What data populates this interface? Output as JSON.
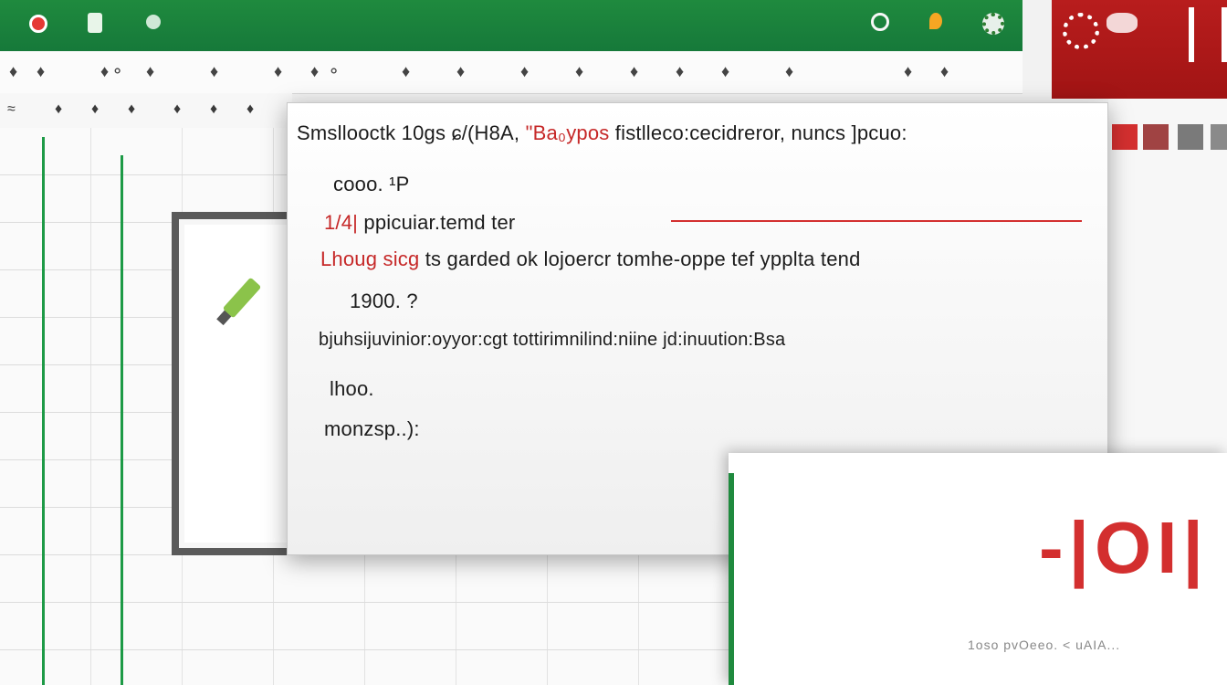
{
  "titlebar": {
    "icons": [
      "record-icon",
      "document-icon",
      "dot-icon",
      "search-icon",
      "pin-icon",
      "gear-icon"
    ]
  },
  "ribbon": {
    "items": [
      "♦",
      "♦",
      "♦⚬",
      "♦",
      "♦",
      "♦",
      "♦ ⚬",
      "♦",
      "♦",
      "♦",
      "♦",
      "♦",
      "♦",
      "♦",
      "♦",
      "♦",
      "♦",
      "♦",
      "♦",
      "♦",
      "♦",
      "♦"
    ]
  },
  "tabs": {
    "items": [
      "≈",
      "♦",
      "♦",
      "♦",
      "♦",
      "♦",
      "♦",
      "♦"
    ]
  },
  "dialog": {
    "line1_pre": "Smsllooctk 10gs",
    "line1_mid": "ɕ/(H8A,",
    "line1_hl": "\"Ba₀ypos",
    "line1_post": "fistlleco:cecidreror, nuncs ]pcuo:",
    "line2": "cooo. ¹P",
    "line3_hl": "1/4|",
    "line3_post": "ppicuiar.temd ter",
    "line4_hl": "Lhoug sicg",
    "line4_post": "ts garded ok lojoercr tomhe-oppe tef ypplta tend",
    "line5": "1900. ?",
    "line6": "bjuhsijuvinior:oyyor:cgt tottirimnilind:niine jd:inuution:Bsa",
    "line7": "lhoo.",
    "line8": "monzsp..):"
  },
  "card": {
    "logo": "-|OI|",
    "footer": "1oso pvOeeo. < uAIA..."
  },
  "accent": {
    "green": "#1f8a3e",
    "red": "#d32f2f"
  }
}
